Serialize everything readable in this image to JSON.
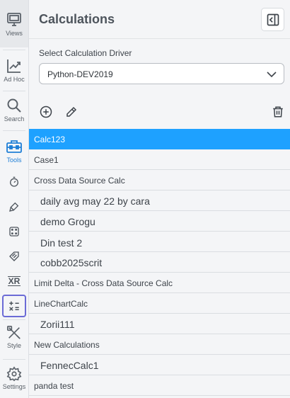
{
  "rail": {
    "views": "Views",
    "adhoc": "Ad Hoc",
    "search": "Search",
    "tools": "Tools",
    "style": "Style",
    "settings": "Settings",
    "sub_xr": "XR"
  },
  "panel": {
    "title": "Calculations",
    "driver_label": "Select Calculation Driver",
    "driver_value": "Python-DEV2019"
  },
  "list": [
    {
      "label": "Calc123",
      "kind": "group",
      "selected": true
    },
    {
      "label": "Case1",
      "kind": "group"
    },
    {
      "label": "Cross Data Source Calc",
      "kind": "group"
    },
    {
      "label": "daily avg may 22 by cara",
      "kind": "child"
    },
    {
      "label": "demo Grogu",
      "kind": "child"
    },
    {
      "label": "Din test 2",
      "kind": "child"
    },
    {
      "label": "cobb2025scrit",
      "kind": "child"
    },
    {
      "label": "Limit Delta - Cross Data Source Calc",
      "kind": "group"
    },
    {
      "label": "LineChartCalc",
      "kind": "group"
    },
    {
      "label": "Zorii111",
      "kind": "child"
    },
    {
      "label": "New Calculations",
      "kind": "group"
    },
    {
      "label": "FennecCalc1",
      "kind": "child"
    },
    {
      "label": "panda test",
      "kind": "group"
    }
  ],
  "colors": {
    "accent": "#1ea1ff",
    "rail_active": "#1f7fd6",
    "calc_highlight": "#6b6bd6"
  }
}
